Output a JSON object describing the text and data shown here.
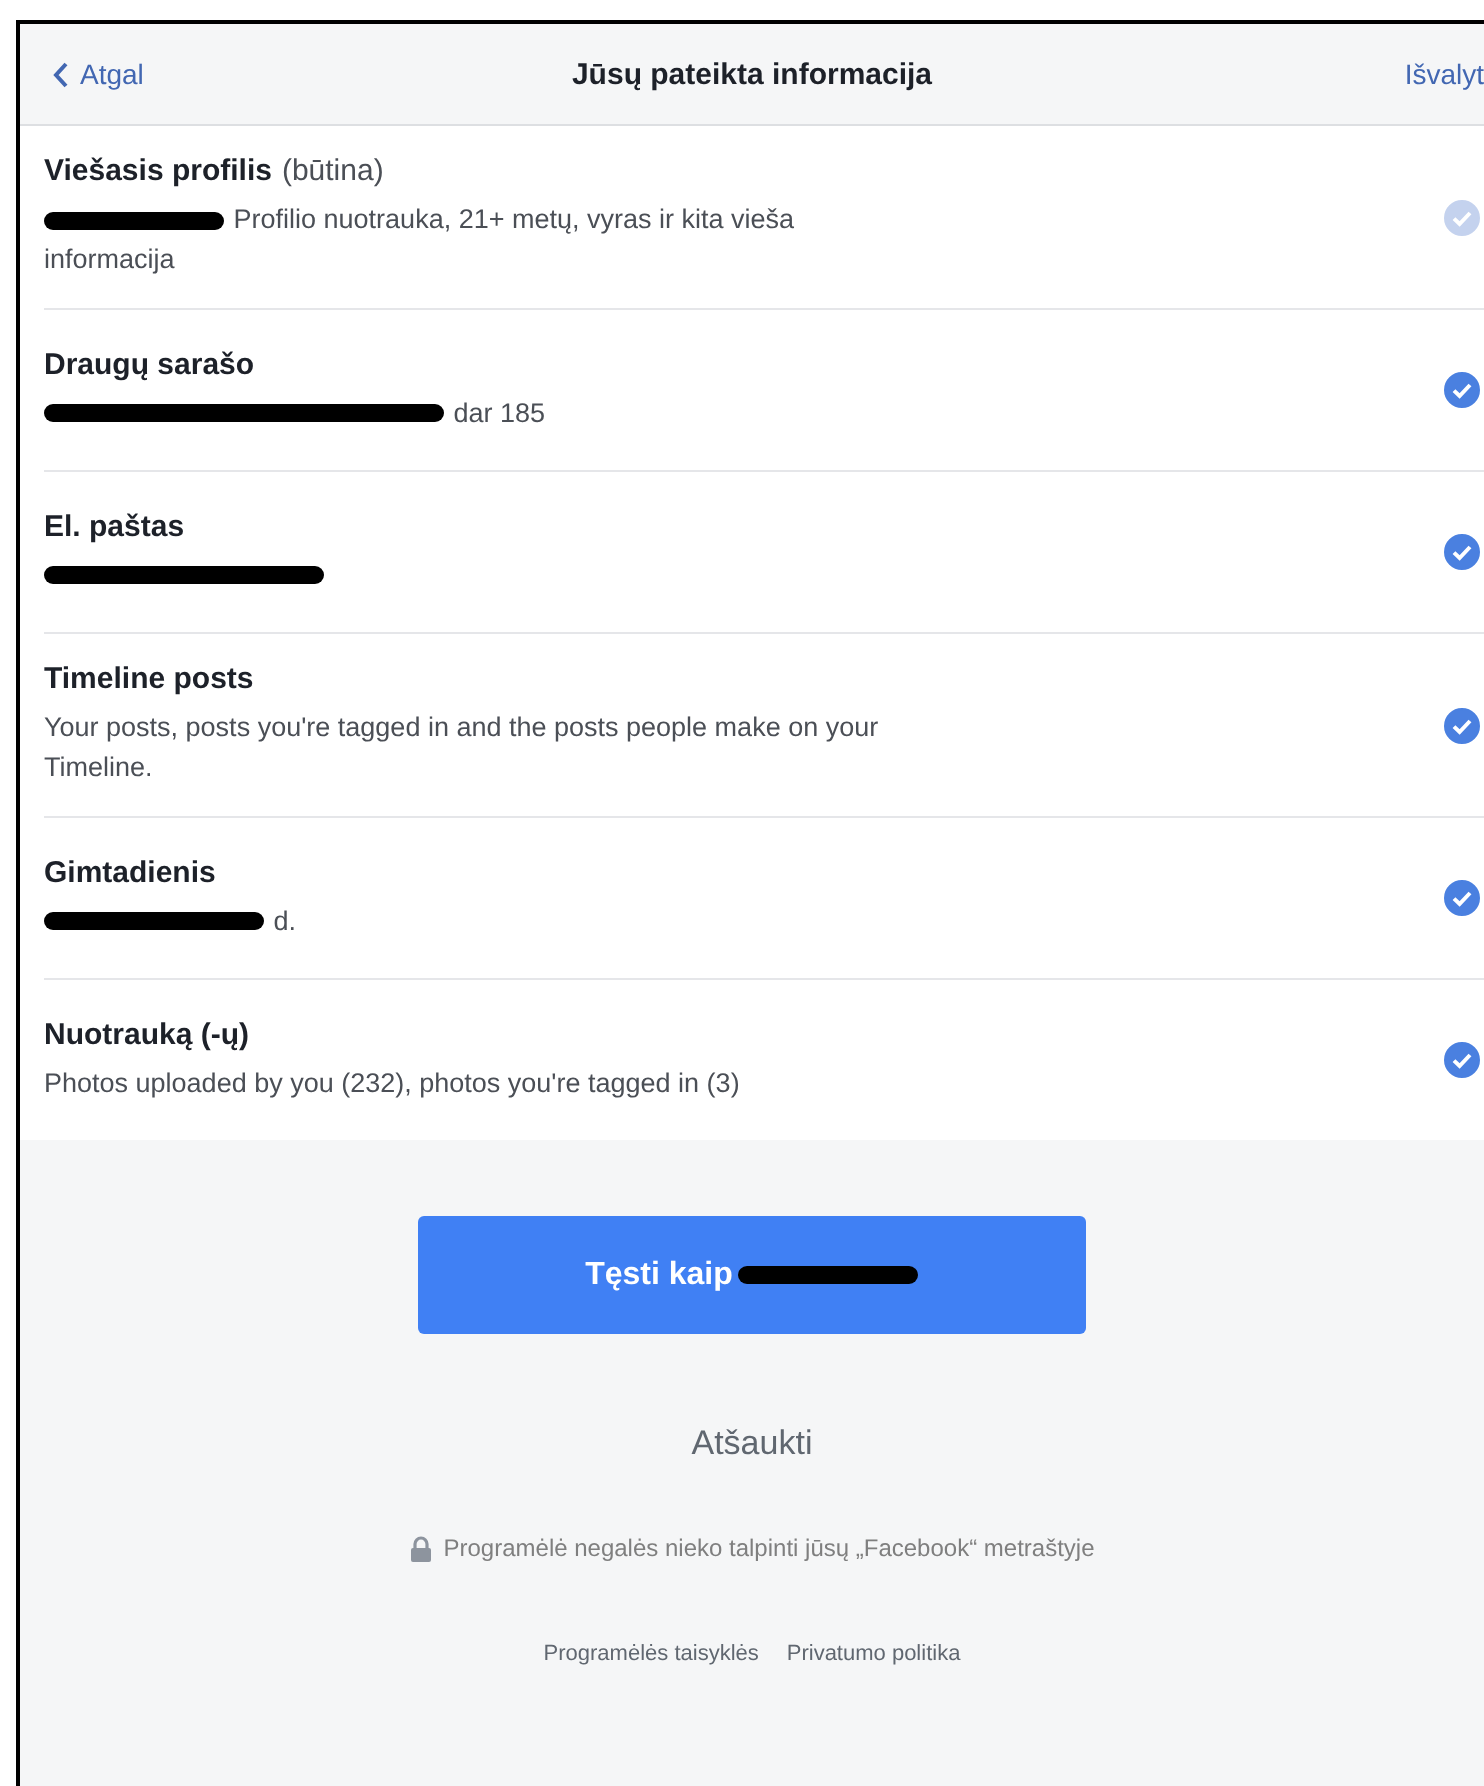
{
  "header": {
    "back": "Atgal",
    "title": "Jūsų pateikta informacija",
    "action": "Išvalyt"
  },
  "items": [
    {
      "title": "Viešasis profilis",
      "note": "(būtina)",
      "redacted": true,
      "detail": "Profilio nuotrauka, 21+ metų, vyras ir kita vieša informacija",
      "checked": true,
      "disabled": true
    },
    {
      "title": "Draugų sarašo",
      "redacted": true,
      "detail": "dar 185",
      "checked": true,
      "disabled": false
    },
    {
      "title": "El. paštas",
      "redacted": true,
      "checked": true,
      "disabled": false
    },
    {
      "title": "Timeline posts",
      "redacted": false,
      "detail": "Your posts, posts you're tagged in and the posts people make on your Timeline.",
      "checked": true,
      "disabled": false
    },
    {
      "title": "Gimtadienis",
      "redacted": true,
      "detail": "d.",
      "checked": true,
      "disabled": false
    },
    {
      "title": "Nuotrauką (-ų)",
      "redacted": false,
      "detail": "Photos uploaded by you (232), photos you're tagged in (3)",
      "checked": true,
      "disabled": false
    }
  ],
  "continue_button": {
    "label": "Tęsti kaip",
    "redacted": true
  },
  "cancel": "Atšaukti",
  "notice": "Programėlė negalės nieko talpinti jūsų „Facebook“ metraštyje",
  "links": [
    "Programėlės taisyklės",
    "Privatumo politika"
  ]
}
